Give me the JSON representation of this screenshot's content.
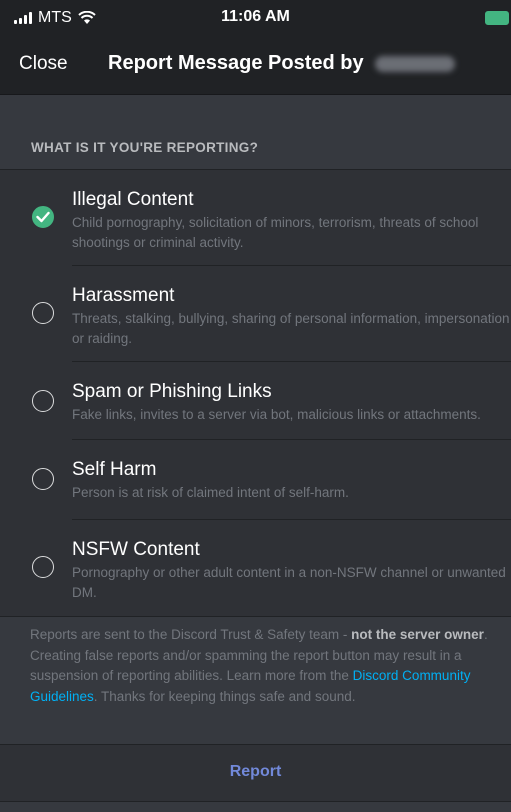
{
  "status_bar": {
    "carrier": "MTS",
    "time": "11:06 AM"
  },
  "header": {
    "close_label": "Close",
    "title": "Report Message Posted by"
  },
  "section_label": "WHAT IS IT YOU'RE REPORTING?",
  "options": [
    {
      "title": "Illegal Content",
      "description": "Child pornography, solicitation of minors, terrorism, threats of school shootings or criminal activity.",
      "selected": true
    },
    {
      "title": "Harassment",
      "description": "Threats, stalking, bullying, sharing of personal information, impersonation or raiding.",
      "selected": false
    },
    {
      "title": "Spam or Phishing Links",
      "description": "Fake links, invites to a server via bot, malicious links or attachments.",
      "selected": false
    },
    {
      "title": "Self Harm",
      "description": "Person is at risk of claimed intent of self-harm.",
      "selected": false
    },
    {
      "title": "NSFW Content",
      "description": "Pornography or other adult content in a non-NSFW channel or unwanted DM.",
      "selected": false
    }
  ],
  "disclaimer": {
    "part1": "Reports are sent to the Discord Trust & Safety team - ",
    "bold": "not the server owner",
    "part2": ". Creating false reports and/or spamming the report button may result in a suspension of reporting abilities. Learn more from the ",
    "link": "Discord Community Guidelines",
    "part3": ". Thanks for keeping things safe and sound."
  },
  "report_label": "Report",
  "colors": {
    "background": "#36393f",
    "panel": "#2f3136",
    "header": "#202225",
    "selected_green": "#43b581",
    "link_blue": "#00b0f4",
    "report_blurple": "#7289da"
  }
}
